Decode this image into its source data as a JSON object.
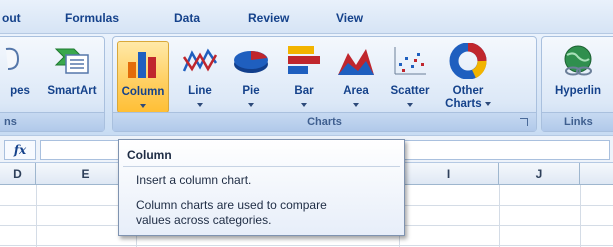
{
  "tabs": [
    "out",
    "Formulas",
    "Data",
    "Review",
    "View"
  ],
  "ribbon": {
    "illustrations": {
      "shapes_label": "pes",
      "smartart_label": "SmartArt",
      "group_label": "ns"
    },
    "charts": {
      "group_label": "Charts",
      "buttons": [
        {
          "label": "Column",
          "icon": "column-chart-icon",
          "active": true
        },
        {
          "label": "Line",
          "icon": "line-chart-icon"
        },
        {
          "label": "Pie",
          "icon": "pie-chart-icon"
        },
        {
          "label": "Bar",
          "icon": "bar-chart-icon"
        },
        {
          "label": "Area",
          "icon": "area-chart-icon"
        },
        {
          "label": "Scatter",
          "icon": "scatter-chart-icon"
        },
        {
          "label_line1": "Other",
          "label_line2": "Charts",
          "icon": "doughnut-chart-icon"
        }
      ]
    },
    "links": {
      "hyperlink_label": "Hyperlin",
      "group_label": "Links"
    }
  },
  "formula_bar": {
    "fx_label": "fx",
    "value": ""
  },
  "columns": [
    "D",
    "E",
    "I",
    "J"
  ],
  "tooltip": {
    "title": "Column",
    "line1": "Insert a column chart.",
    "line2a": "Column charts are used to compare",
    "line2b": "values across categories."
  },
  "colors": {
    "active_button": "#ffd26a",
    "ribbon_text": "#15428b",
    "group_border": "#a9c0de"
  }
}
